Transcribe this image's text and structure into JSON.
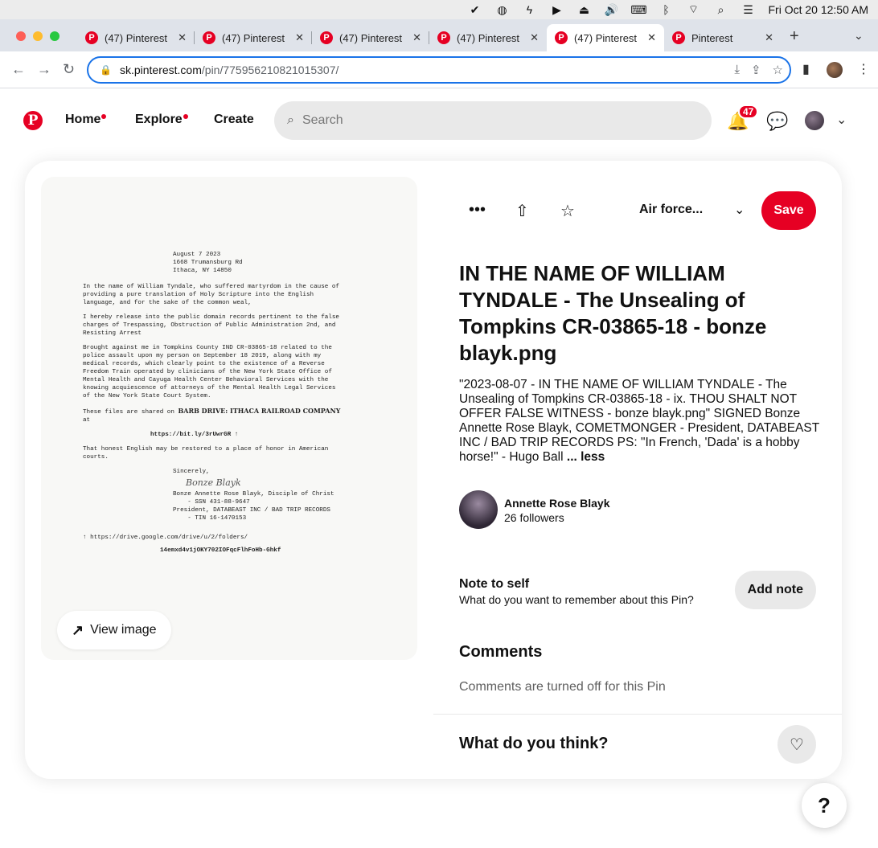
{
  "menubar": {
    "icons": [
      "check-icon",
      "audio-icon",
      "bolt-icon",
      "play-icon",
      "eject-icon",
      "volume-icon",
      "keyboard-icon",
      "bluetooth-icon",
      "wifi-icon",
      "search-icon",
      "control-center-icon"
    ],
    "datetime": "Fri Oct 20  12:50 AM"
  },
  "browser": {
    "tabs": [
      {
        "title": "(47) Pinterest",
        "active": false
      },
      {
        "title": "(47) Pinterest",
        "active": false
      },
      {
        "title": "(47) Pinterest",
        "active": false
      },
      {
        "title": "(47) Pinterest",
        "active": false
      },
      {
        "title": "(47) Pinterest",
        "active": true
      },
      {
        "title": "Pinterest",
        "active": false
      }
    ],
    "url_host": "sk.pinterest.com",
    "url_path": "/pin/775956210821015307/"
  },
  "header": {
    "nav": [
      {
        "label": "Home",
        "dot": true
      },
      {
        "label": "Explore",
        "dot": true
      },
      {
        "label": "Create",
        "dot": false
      }
    ],
    "search_placeholder": "Search",
    "notification_count": "47",
    "brand_color": "#e60023"
  },
  "pin": {
    "image_letter": {
      "date": "August 7 2023",
      "addr1": "1668 Trumansburg Rd",
      "addr2": "Ithaca, NY 14850",
      "p1": "In the name of William Tyndale, who suffered martyrdom in the cause of\nproviding a pure translation of Holy Scripture into the English\nlanguage, and for the sake of the common weal,",
      "p2": "I hereby release into the public domain records pertinent to the false\ncharges of Trespassing, Obstruction of Public Administration 2nd, and\nResisting Arrest",
      "p3": "Brought against me in Tompkins County IND CR-03865-18 related to the\npolice assault upon my person on September 18 2019, along with my\nmedical records, which clearly point to the existence of a Reverse\nFreedom Train operated by clinicians of the New York State Office of\nMental Health and Cayuga Health Center Behavioral Services with the\nknowing acquiescence of attorneys of the Mental Health Legal Services\nof the New York State Court System.",
      "p4a": "These files are shared on ",
      "p4b": "BARB DRIVE: ITHACA RAILROAD COMPANY",
      "p4c": "at",
      "link": "https://bit.ly/3rUwrGR ↑",
      "p5": "That honest English may be restored to a place of honor in American\ncourts.",
      "closing": "Sincerely,",
      "signature": "Bonze Blayk",
      "sig1": "Bonze Annette Rose Blayk, Disciple of Christ",
      "sig2": "    - SSN 431-88-9647",
      "sig3": "President, DATABEAST INC / BAD TRIP RECORDS",
      "sig4": "    - TIN 16-1470153",
      "foot1": "↑ https://drive.google.com/drive/u/2/folders/",
      "foot2": "14emxd4v1jOKY702IOFqcFlhFoHb-Ghkf"
    },
    "view_image_label": "View image",
    "board_name": "Air force...",
    "save_label": "Save",
    "title": "IN THE NAME OF WILLIAM TYNDALE - The Unsealing of Tompkins CR-03865-18 - bonze blayk.png",
    "description": "\"2023-08-07 - IN THE NAME OF WILLIAM TYNDALE - The Unsealing of Tompkins CR-03865-18 - ix. THOU SHALT NOT OFFER FALSE WITNESS - bonze blayk.png\" SIGNED Bonze Annette Rose Blayk, COMETMONGER - President, DATABEAST INC / BAD TRIP RECORDS PS: \"In French, 'Dada' is a hobby horse!\" - Hugo Ball",
    "less_label": "... less",
    "creator_name": "Annette Rose Blayk",
    "creator_followers": "26 followers",
    "note_title": "Note to self",
    "note_subtitle": "What do you want to remember about this Pin?",
    "add_note_label": "Add note",
    "comments_heading": "Comments",
    "comments_off": "Comments are turned off for this Pin",
    "think_label": "What do you think?"
  },
  "help_label": "?"
}
